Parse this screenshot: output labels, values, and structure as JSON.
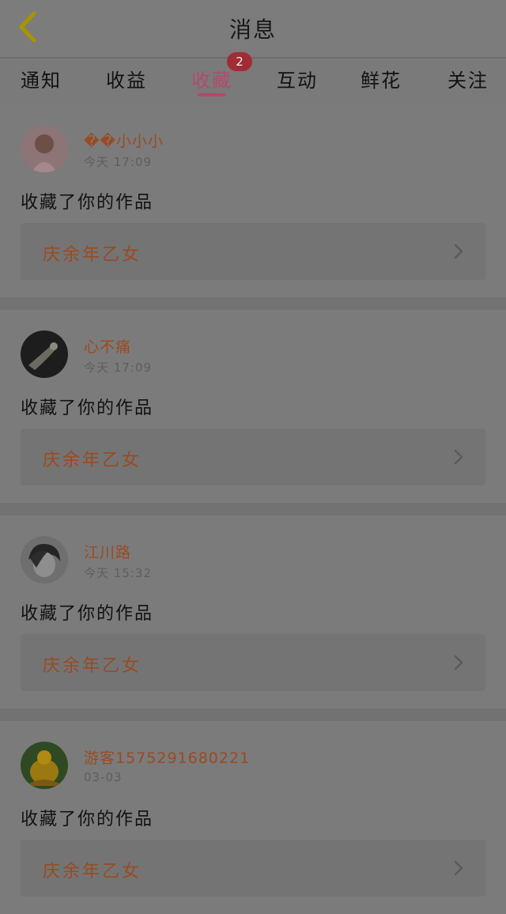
{
  "header": {
    "title": "消息"
  },
  "tabs": [
    {
      "label": "通知"
    },
    {
      "label": "收益"
    },
    {
      "label": "收藏",
      "badge": "2",
      "active": true
    },
    {
      "label": "互动"
    },
    {
      "label": "鲜花"
    },
    {
      "label": "关注"
    }
  ],
  "messages": [
    {
      "user": "��小小小",
      "time": "今天 17:09",
      "action": "收藏了你的作品",
      "work": "庆余年乙女",
      "avatar": "user-avatar-1"
    },
    {
      "user": "心不痛",
      "time": "今天 17:09",
      "action": "收藏了你的作品",
      "work": "庆余年乙女",
      "avatar": "user-avatar-2"
    },
    {
      "user": "江川路",
      "time": "今天 15:32",
      "action": "收藏了你的作品",
      "work": "庆余年乙女",
      "avatar": "user-avatar-3"
    },
    {
      "user": "游客1575291680221",
      "time": "03-03",
      "action": "收藏了你的作品",
      "work": "庆余年乙女",
      "avatar": "user-avatar-4"
    }
  ],
  "colors": {
    "accent": "#b24a6a",
    "username": "#9a4a22",
    "badge": "#a02c35"
  }
}
